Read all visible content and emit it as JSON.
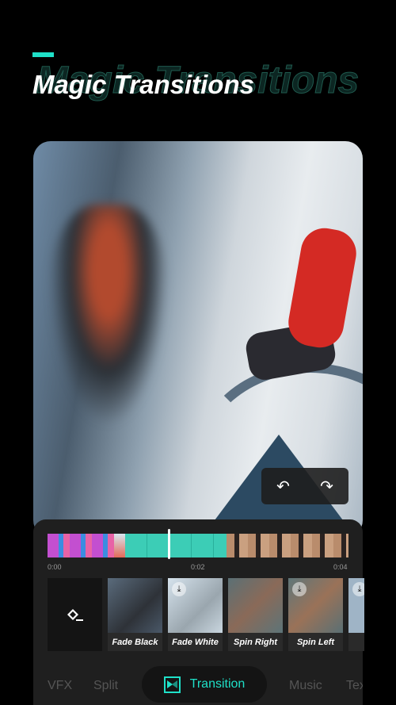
{
  "header": {
    "title": "Magic Transitions",
    "ghost_title": "Magic Transitions",
    "accent": "#1fe0c8"
  },
  "preview": {
    "undo_icon": "undo-icon",
    "redo_icon": "redo-icon",
    "undo": "↶",
    "redo": "↷"
  },
  "timeline": {
    "labels": [
      "0:00",
      "0:02",
      "0:04"
    ]
  },
  "transitions": [
    {
      "label": "Fade Black",
      "download": false
    },
    {
      "label": "Fade White",
      "download": true
    },
    {
      "label": "Spin Right",
      "download": false
    },
    {
      "label": "Spin Left",
      "download": true
    },
    {
      "label": "",
      "download": true
    }
  ],
  "tabs": {
    "items": [
      "VFX",
      "Split",
      "Transition",
      "Music",
      "Text"
    ],
    "active": "Transition"
  }
}
